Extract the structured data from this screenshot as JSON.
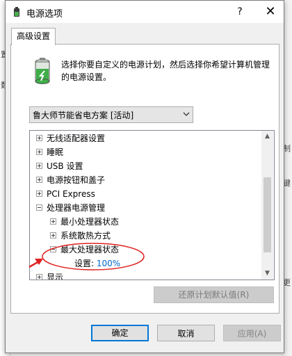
{
  "window": {
    "title": "电源选项",
    "help_label": "?",
    "close_label": "✕"
  },
  "tab": {
    "label": "高级设置"
  },
  "description": "选择你要自定义的电源计划，然后选择你希望计算机管理的电源设置。",
  "plan_select": {
    "value": "鲁大师节能省电方案 [活动]"
  },
  "tree": {
    "items": [
      {
        "label": "无线适配器设置",
        "state": "collapsed"
      },
      {
        "label": "睡眠",
        "state": "collapsed"
      },
      {
        "label": "USB 设置",
        "state": "collapsed"
      },
      {
        "label": "电源按钮和盖子",
        "state": "collapsed"
      },
      {
        "label": "PCI Express",
        "state": "collapsed"
      },
      {
        "label": "处理器电源管理",
        "state": "expanded"
      },
      {
        "label": "最小处理器状态",
        "state": "collapsed"
      },
      {
        "label": "系统散热方式",
        "state": "collapsed"
      },
      {
        "label": "最大处理器状态",
        "state": "expanded"
      },
      {
        "label": "显示",
        "state": "collapsed"
      }
    ],
    "setting": {
      "label": "设置:",
      "value": "100%"
    }
  },
  "buttons": {
    "restore": "还原计划默认值(R)",
    "ok": "确定",
    "cancel": "取消",
    "apply": "应用(A)"
  },
  "background_fragments": [
    "置",
    "数",
    "制",
    "键",
    "更"
  ],
  "colors": {
    "accent": "#0078d7",
    "link": "#0066cc",
    "annotation": "#e02020"
  }
}
